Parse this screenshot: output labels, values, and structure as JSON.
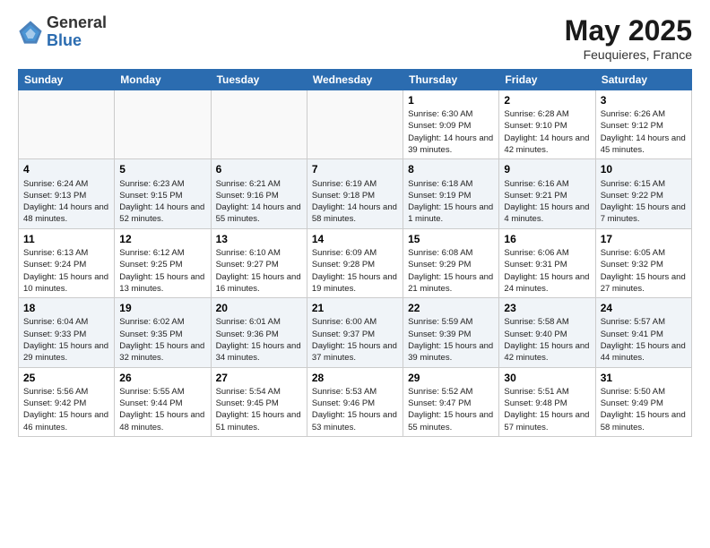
{
  "logo": {
    "general": "General",
    "blue": "Blue"
  },
  "title": "May 2025",
  "subtitle": "Feuquieres, France",
  "headers": [
    "Sunday",
    "Monday",
    "Tuesday",
    "Wednesday",
    "Thursday",
    "Friday",
    "Saturday"
  ],
  "weeks": [
    [
      {
        "day": "",
        "info": ""
      },
      {
        "day": "",
        "info": ""
      },
      {
        "day": "",
        "info": ""
      },
      {
        "day": "",
        "info": ""
      },
      {
        "day": "1",
        "info": "Sunrise: 6:30 AM\nSunset: 9:09 PM\nDaylight: 14 hours\nand 39 minutes."
      },
      {
        "day": "2",
        "info": "Sunrise: 6:28 AM\nSunset: 9:10 PM\nDaylight: 14 hours\nand 42 minutes."
      },
      {
        "day": "3",
        "info": "Sunrise: 6:26 AM\nSunset: 9:12 PM\nDaylight: 14 hours\nand 45 minutes."
      }
    ],
    [
      {
        "day": "4",
        "info": "Sunrise: 6:24 AM\nSunset: 9:13 PM\nDaylight: 14 hours\nand 48 minutes."
      },
      {
        "day": "5",
        "info": "Sunrise: 6:23 AM\nSunset: 9:15 PM\nDaylight: 14 hours\nand 52 minutes."
      },
      {
        "day": "6",
        "info": "Sunrise: 6:21 AM\nSunset: 9:16 PM\nDaylight: 14 hours\nand 55 minutes."
      },
      {
        "day": "7",
        "info": "Sunrise: 6:19 AM\nSunset: 9:18 PM\nDaylight: 14 hours\nand 58 minutes."
      },
      {
        "day": "8",
        "info": "Sunrise: 6:18 AM\nSunset: 9:19 PM\nDaylight: 15 hours\nand 1 minute."
      },
      {
        "day": "9",
        "info": "Sunrise: 6:16 AM\nSunset: 9:21 PM\nDaylight: 15 hours\nand 4 minutes."
      },
      {
        "day": "10",
        "info": "Sunrise: 6:15 AM\nSunset: 9:22 PM\nDaylight: 15 hours\nand 7 minutes."
      }
    ],
    [
      {
        "day": "11",
        "info": "Sunrise: 6:13 AM\nSunset: 9:24 PM\nDaylight: 15 hours\nand 10 minutes."
      },
      {
        "day": "12",
        "info": "Sunrise: 6:12 AM\nSunset: 9:25 PM\nDaylight: 15 hours\nand 13 minutes."
      },
      {
        "day": "13",
        "info": "Sunrise: 6:10 AM\nSunset: 9:27 PM\nDaylight: 15 hours\nand 16 minutes."
      },
      {
        "day": "14",
        "info": "Sunrise: 6:09 AM\nSunset: 9:28 PM\nDaylight: 15 hours\nand 19 minutes."
      },
      {
        "day": "15",
        "info": "Sunrise: 6:08 AM\nSunset: 9:29 PM\nDaylight: 15 hours\nand 21 minutes."
      },
      {
        "day": "16",
        "info": "Sunrise: 6:06 AM\nSunset: 9:31 PM\nDaylight: 15 hours\nand 24 minutes."
      },
      {
        "day": "17",
        "info": "Sunrise: 6:05 AM\nSunset: 9:32 PM\nDaylight: 15 hours\nand 27 minutes."
      }
    ],
    [
      {
        "day": "18",
        "info": "Sunrise: 6:04 AM\nSunset: 9:33 PM\nDaylight: 15 hours\nand 29 minutes."
      },
      {
        "day": "19",
        "info": "Sunrise: 6:02 AM\nSunset: 9:35 PM\nDaylight: 15 hours\nand 32 minutes."
      },
      {
        "day": "20",
        "info": "Sunrise: 6:01 AM\nSunset: 9:36 PM\nDaylight: 15 hours\nand 34 minutes."
      },
      {
        "day": "21",
        "info": "Sunrise: 6:00 AM\nSunset: 9:37 PM\nDaylight: 15 hours\nand 37 minutes."
      },
      {
        "day": "22",
        "info": "Sunrise: 5:59 AM\nSunset: 9:39 PM\nDaylight: 15 hours\nand 39 minutes."
      },
      {
        "day": "23",
        "info": "Sunrise: 5:58 AM\nSunset: 9:40 PM\nDaylight: 15 hours\nand 42 minutes."
      },
      {
        "day": "24",
        "info": "Sunrise: 5:57 AM\nSunset: 9:41 PM\nDaylight: 15 hours\nand 44 minutes."
      }
    ],
    [
      {
        "day": "25",
        "info": "Sunrise: 5:56 AM\nSunset: 9:42 PM\nDaylight: 15 hours\nand 46 minutes."
      },
      {
        "day": "26",
        "info": "Sunrise: 5:55 AM\nSunset: 9:44 PM\nDaylight: 15 hours\nand 48 minutes."
      },
      {
        "day": "27",
        "info": "Sunrise: 5:54 AM\nSunset: 9:45 PM\nDaylight: 15 hours\nand 51 minutes."
      },
      {
        "day": "28",
        "info": "Sunrise: 5:53 AM\nSunset: 9:46 PM\nDaylight: 15 hours\nand 53 minutes."
      },
      {
        "day": "29",
        "info": "Sunrise: 5:52 AM\nSunset: 9:47 PM\nDaylight: 15 hours\nand 55 minutes."
      },
      {
        "day": "30",
        "info": "Sunrise: 5:51 AM\nSunset: 9:48 PM\nDaylight: 15 hours\nand 57 minutes."
      },
      {
        "day": "31",
        "info": "Sunrise: 5:50 AM\nSunset: 9:49 PM\nDaylight: 15 hours\nand 58 minutes."
      }
    ]
  ]
}
